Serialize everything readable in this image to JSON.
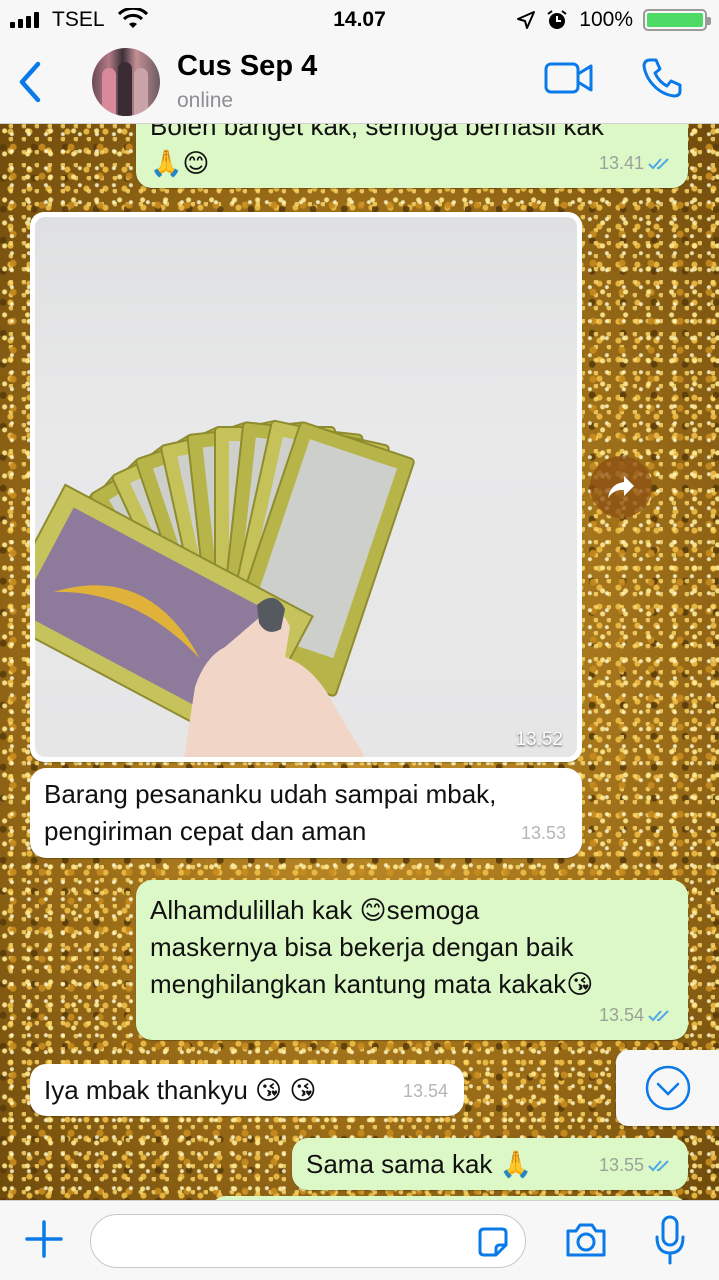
{
  "status_bar": {
    "carrier": "TSEL",
    "time": "14.07",
    "battery": "100%",
    "battery_level": 1.0
  },
  "header": {
    "contact_name": "Cus Sep 4",
    "contact_status": "online"
  },
  "messages": [
    {
      "dir": "out",
      "text_lines": [
        "Boleh banget kak, semoga berhasil kak",
        "🙏😊"
      ],
      "time": "13.41",
      "status": "read"
    },
    {
      "dir": "in",
      "type": "image",
      "time": "13.52"
    },
    {
      "dir": "in",
      "text_lines": [
        "Barang pesananku udah sampai mbak,",
        "pengiriman cepat dan aman"
      ],
      "time": "13.53"
    },
    {
      "dir": "out",
      "text_lines": [
        "Alhamdulillah kak 😊semoga",
        "maskernya bisa bekerja dengan baik",
        "menghilangkan kantung mata kakak😘"
      ],
      "time": "13.54",
      "status": "read"
    },
    {
      "dir": "in",
      "text_lines": [
        "Iya mbak thankyu 😘 😘"
      ],
      "time": "13.54"
    },
    {
      "dir": "out",
      "text_lines": [
        "Sama sama kak 🙏"
      ],
      "time": "13.55",
      "status": "read"
    }
  ],
  "input": {
    "placeholder": ""
  },
  "icons": {
    "back": "chevron-left-icon",
    "video": "video-camera-icon",
    "call": "phone-icon",
    "forward": "forward-arrow-icon",
    "scroll": "chevron-down-circle-icon",
    "plus": "plus-icon",
    "sticker": "sticker-icon",
    "camera": "camera-icon",
    "mic": "microphone-icon"
  },
  "colors": {
    "accent": "#0a7ae8",
    "outgoing_bubble": "#dcf8c6",
    "incoming_bubble": "#ffffff",
    "read_ticks": "#4fa8e8",
    "battery_fill": "#4cd964"
  }
}
